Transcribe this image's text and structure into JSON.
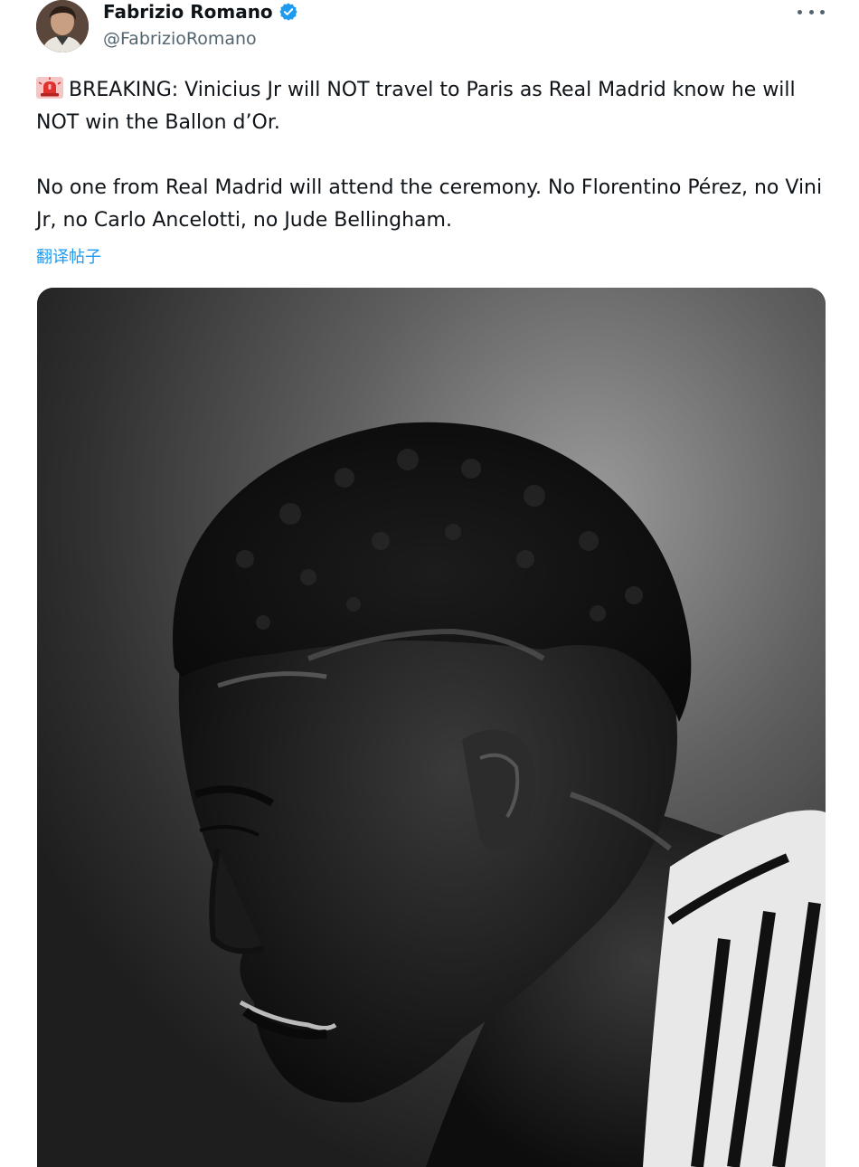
{
  "author": {
    "display_name": "Fabrizio Romano",
    "handle": "@FabrizioRomano",
    "verified": true,
    "avatar_icon": "avatar-photo"
  },
  "menu": {
    "icon": "more-horizontal-icon"
  },
  "tweet": {
    "emoji_icon": "siren-icon",
    "paragraph_1": "BREAKING: Vinicius Jr will NOT travel to Paris as Real Madrid know he will NOT win the Ballon d’Or.",
    "paragraph_2": "No one from Real Madrid will attend the ceremony. No Florentino Pérez, no Vini Jr, no Carlo Ancelotti, no Jude Bellingham.",
    "translate_label": "翻译帖子"
  },
  "colors": {
    "link_blue": "#1d9bf0",
    "verified_blue": "#1d9bf0",
    "secondary_text": "#536471",
    "primary_text": "#0f1419"
  }
}
